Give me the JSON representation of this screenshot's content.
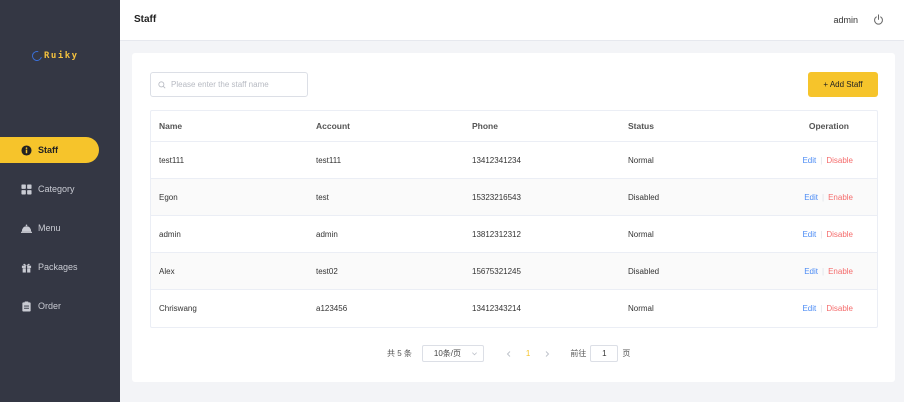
{
  "brand": {
    "name": "Ruiky"
  },
  "sidebar": {
    "items": [
      {
        "label": "Staff",
        "icon": "info-circle-icon",
        "active": true
      },
      {
        "label": "Category",
        "icon": "grid-icon",
        "active": false
      },
      {
        "label": "Menu",
        "icon": "cloche-icon",
        "active": false
      },
      {
        "label": "Packages",
        "icon": "gift-icon",
        "active": false
      },
      {
        "label": "Order",
        "icon": "clipboard-icon",
        "active": false
      }
    ]
  },
  "header": {
    "title": "Staff",
    "user": "admin",
    "logout_icon": "power-icon"
  },
  "toolbar": {
    "search_placeholder": "Please enter the staff name",
    "add_label": "+ Add Staff"
  },
  "table": {
    "columns": [
      "Name",
      "Account",
      "Phone",
      "Status",
      "Operation"
    ],
    "rows": [
      {
        "name": "test111",
        "account": "test111",
        "phone": "13412341234",
        "status": "Normal",
        "edit": "Edit",
        "toggle": "Disable"
      },
      {
        "name": "Egon",
        "account": "test",
        "phone": "15323216543",
        "status": "Disabled",
        "edit": "Edit",
        "toggle": "Enable"
      },
      {
        "name": "admin",
        "account": "admin",
        "phone": "13812312312",
        "status": "Normal",
        "edit": "Edit",
        "toggle": "Disable"
      },
      {
        "name": "Alex",
        "account": "test02",
        "phone": "15675321245",
        "status": "Disabled",
        "edit": "Edit",
        "toggle": "Enable"
      },
      {
        "name": "Chriswang",
        "account": "a123456",
        "phone": "13412343214",
        "status": "Normal",
        "edit": "Edit",
        "toggle": "Disable"
      }
    ]
  },
  "pagination": {
    "total": "共 5 条",
    "page_size": "10条/页",
    "current_page": "1",
    "goto_label": "前往",
    "goto_value": "1",
    "goto_unit": "页"
  },
  "colors": {
    "accent": "#f6c42b",
    "sidebar": "#343744",
    "link": "#4c8cf5",
    "danger": "#f56c6c"
  }
}
